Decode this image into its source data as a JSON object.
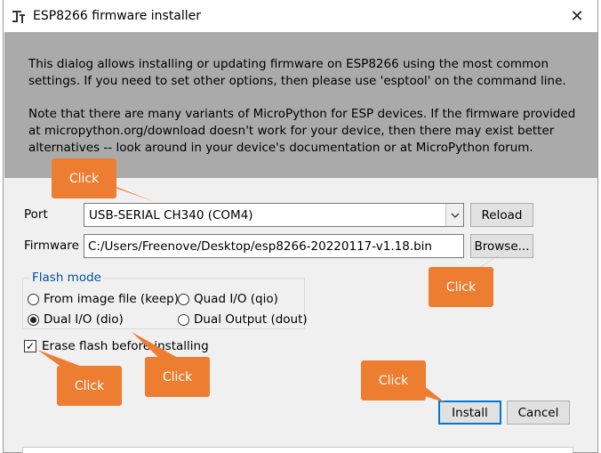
{
  "window": {
    "title": "ESP8266 firmware installer",
    "close_glyph": "✕"
  },
  "info": {
    "paragraph1": "This dialog allows installing or updating firmware on ESP8266 using the most common settings. If you need to set other options, then please use 'esptool' on the command line.",
    "paragraph2": "Note that there are many variants of MicroPython for ESP devices. If the firmware provided at micropython.org/download doesn't work for your device, then there may exist better alternatives -- look around in your device's documentation or at MicroPython forum."
  },
  "form": {
    "port_label": "Port",
    "port_value": "USB-SERIAL CH340 (COM4)",
    "reload_label": "Reload",
    "firmware_label": "Firmware",
    "firmware_value": "C:/Users/Freenove/Desktop/esp8266-20220117-v1.18.bin",
    "browse_label": "Browse..."
  },
  "flash_mode": {
    "title": "Flash mode",
    "options": [
      {
        "label": "From image file (keep)",
        "selected": false
      },
      {
        "label": "Quad I/O (qio)",
        "selected": false
      },
      {
        "label": "Dual I/O (dio)",
        "selected": true
      },
      {
        "label": "Dual Output (dout)",
        "selected": false
      }
    ]
  },
  "erase": {
    "label": "Erase flash before installing",
    "checked": true
  },
  "buttons": {
    "install_label": "Install",
    "cancel_label": "Cancel"
  },
  "annotations": {
    "callout_text": "Click",
    "color": "#ed7d31"
  },
  "colors": {
    "info_bg": "#aaaaaa",
    "window_bg": "#f0f0f0",
    "accent": "#0078d7",
    "group_title": "#0050a0"
  },
  "icons": {
    "app": "tree-icon",
    "dropdown": "chevron-down-icon",
    "check": "check-icon"
  }
}
